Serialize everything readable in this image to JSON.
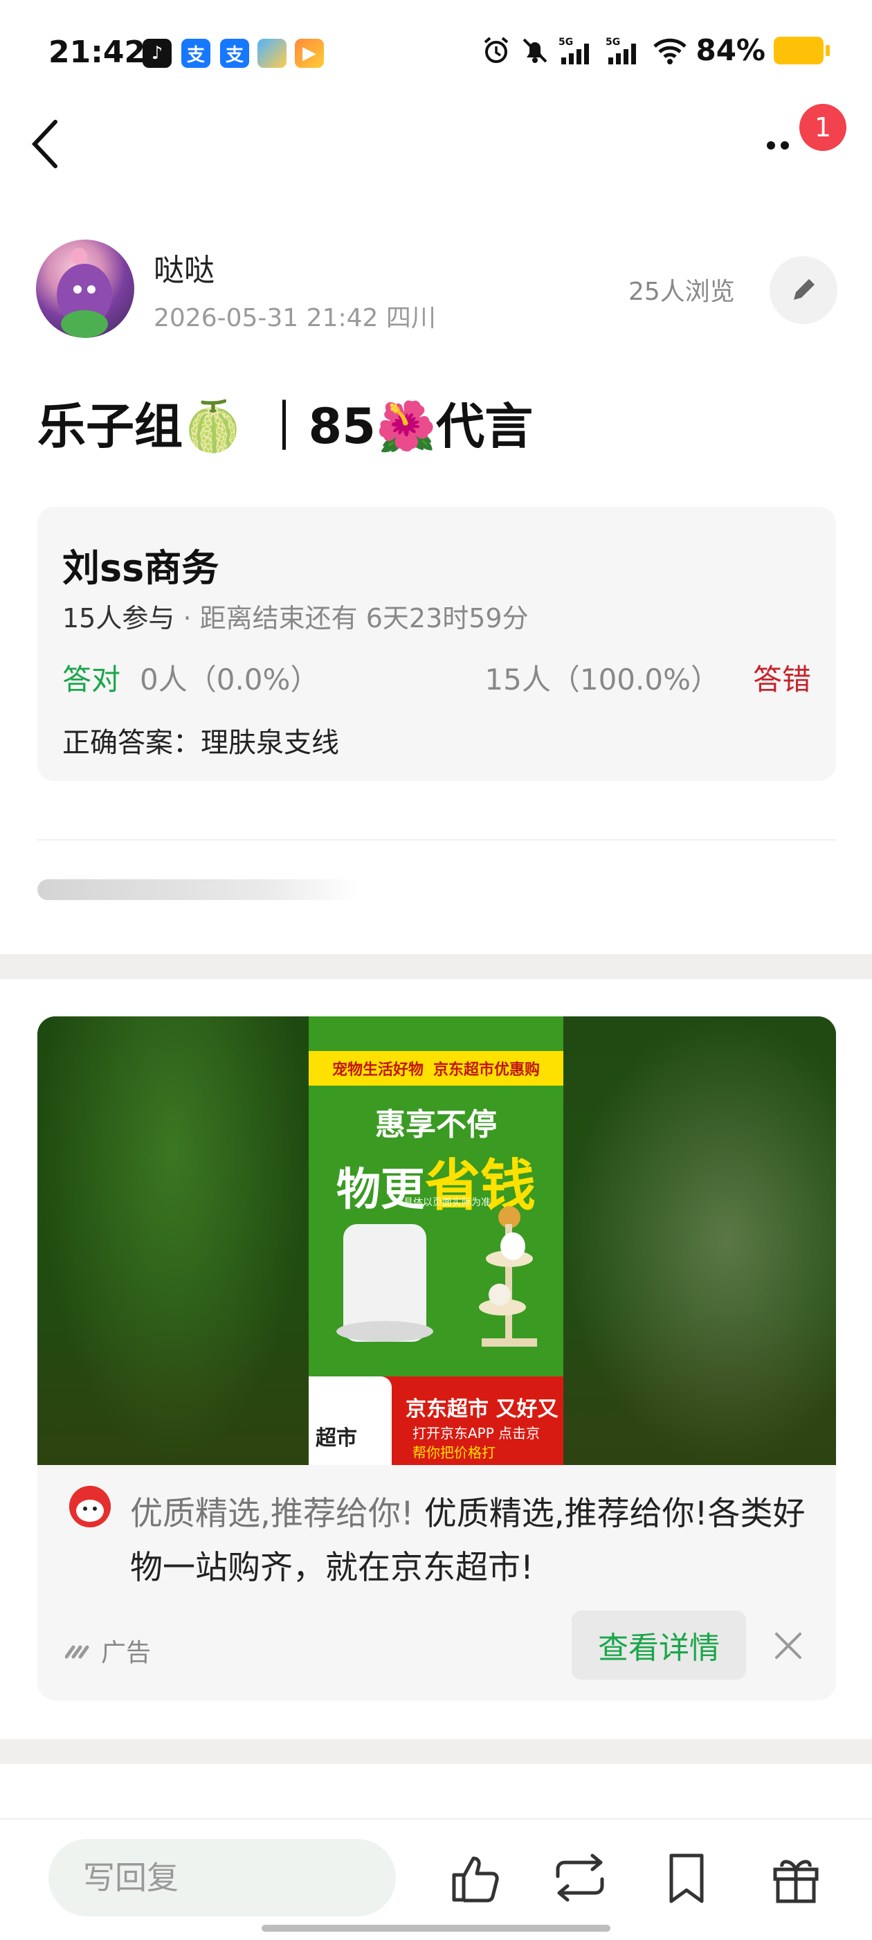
{
  "status_bar": {
    "time": "21:42",
    "network": "5G",
    "battery": "84%",
    "app_icons": [
      "tiktok-icon",
      "alipay-icon",
      "alipay-icon",
      "cloud-app-icon",
      "video-app-icon"
    ]
  },
  "nav": {
    "notification_count": "1"
  },
  "post": {
    "author_name": "哒哒",
    "meta": "2026-05-31 21:42  四川",
    "views": "25人浏览",
    "title": "乐子组🍈 ｜85🌺代言"
  },
  "quiz": {
    "title": "刘ss商务",
    "participants": "15人参与",
    "separator": "·",
    "deadline": "距离结束还有 6天23时59分",
    "correct_label": "答对",
    "correct_stat": "0人（0.0%）",
    "wrong_stat": "15人（100.0%）",
    "wrong_label": "答错",
    "answer": "正确答案：理肤泉支线",
    "accent_correct": "#1aa64b",
    "accent_wrong": "#c7232a"
  },
  "ad": {
    "poster": {
      "top_left": "宠物生活好物",
      "top_right": "京东超市优惠购",
      "headline1": "惠享不停",
      "headline2_a": "物更",
      "headline2_b": "省钱",
      "note": "*具体以页面实际为准",
      "bottom_title": "京东超市 又好又",
      "bottom_sub1": "打开京东APP 点击京",
      "bottom_sub2": "帮你把价格打",
      "phone_label": "超市"
    },
    "text_lead": "优质精选,推荐给你!",
    "text_body": "优质精选,推荐给你!各类好物一站购齐，就在京东超市!",
    "label": "广告",
    "detail_button": "查看详情"
  },
  "bottom_bar": {
    "reply_placeholder": "写回复",
    "icons": [
      "thumb-up-icon",
      "repost-icon",
      "bookmark-icon",
      "gift-icon"
    ]
  }
}
